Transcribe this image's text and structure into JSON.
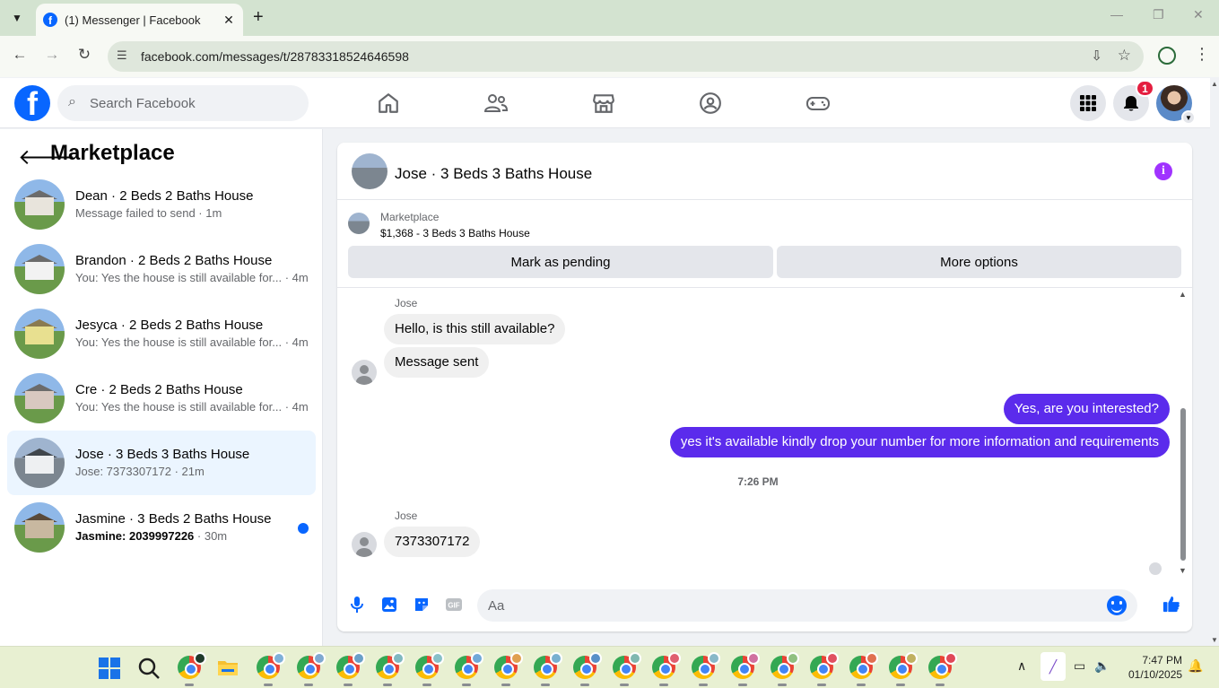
{
  "browser": {
    "tab_title": "(1) Messenger | Facebook",
    "url": "facebook.com/messages/t/28783318524646598"
  },
  "fb_header": {
    "search_placeholder": "Search Facebook",
    "notification_count": "1",
    "brand_color": "#0866ff"
  },
  "sidebar": {
    "title": "Marketplace",
    "conversations": [
      {
        "name": "Dean · 2 Beds 2 Baths House",
        "sub": "Message failed to send · 1m",
        "unread": false,
        "active": false
      },
      {
        "name": "Brandon · 2 Beds 2 Baths House",
        "sub": "You: Yes the house is still available for...",
        "time": "· 4m",
        "unread": false,
        "active": false
      },
      {
        "name": "Jesyca · 2 Beds 2 Baths House",
        "sub": "You: Yes the house is still available for...",
        "time": "· 4m",
        "unread": false,
        "active": false
      },
      {
        "name": "Cre · 2 Beds 2 Baths House",
        "sub": "You: Yes the house is still available for...",
        "time": "· 4m",
        "unread": false,
        "active": false
      },
      {
        "name": "Jose · 3 Beds 3 Baths House",
        "sub": "Jose: 7373307172 · 21m",
        "unread": false,
        "active": true
      },
      {
        "name": "Jasmine · 3 Beds 2 Baths House",
        "sub": "Jasmine: 2039997226",
        "time": " · 30m",
        "unread": true,
        "active": false
      }
    ]
  },
  "chat": {
    "title": "Jose · 3 Beds 3 Baths House",
    "marketplace_label": "Marketplace",
    "listing": "$1,368 - 3 Beds 3 Baths House",
    "btn_pending": "Mark as pending",
    "btn_more": "More options",
    "messages": {
      "sender1": "Jose",
      "in1": "Hello, is this still available?",
      "in2": "Message sent",
      "out1": "Yes, are you interested?",
      "out2": "yes it's available kindly drop your number for more information and requirements",
      "time": "7:26 PM",
      "sender2": "Jose",
      "in3": "7373307172"
    },
    "composer_placeholder": "Aa",
    "accent_color": "#5b2bec"
  },
  "taskbar": {
    "time": "7:47 PM",
    "date": "01/10/2025"
  }
}
